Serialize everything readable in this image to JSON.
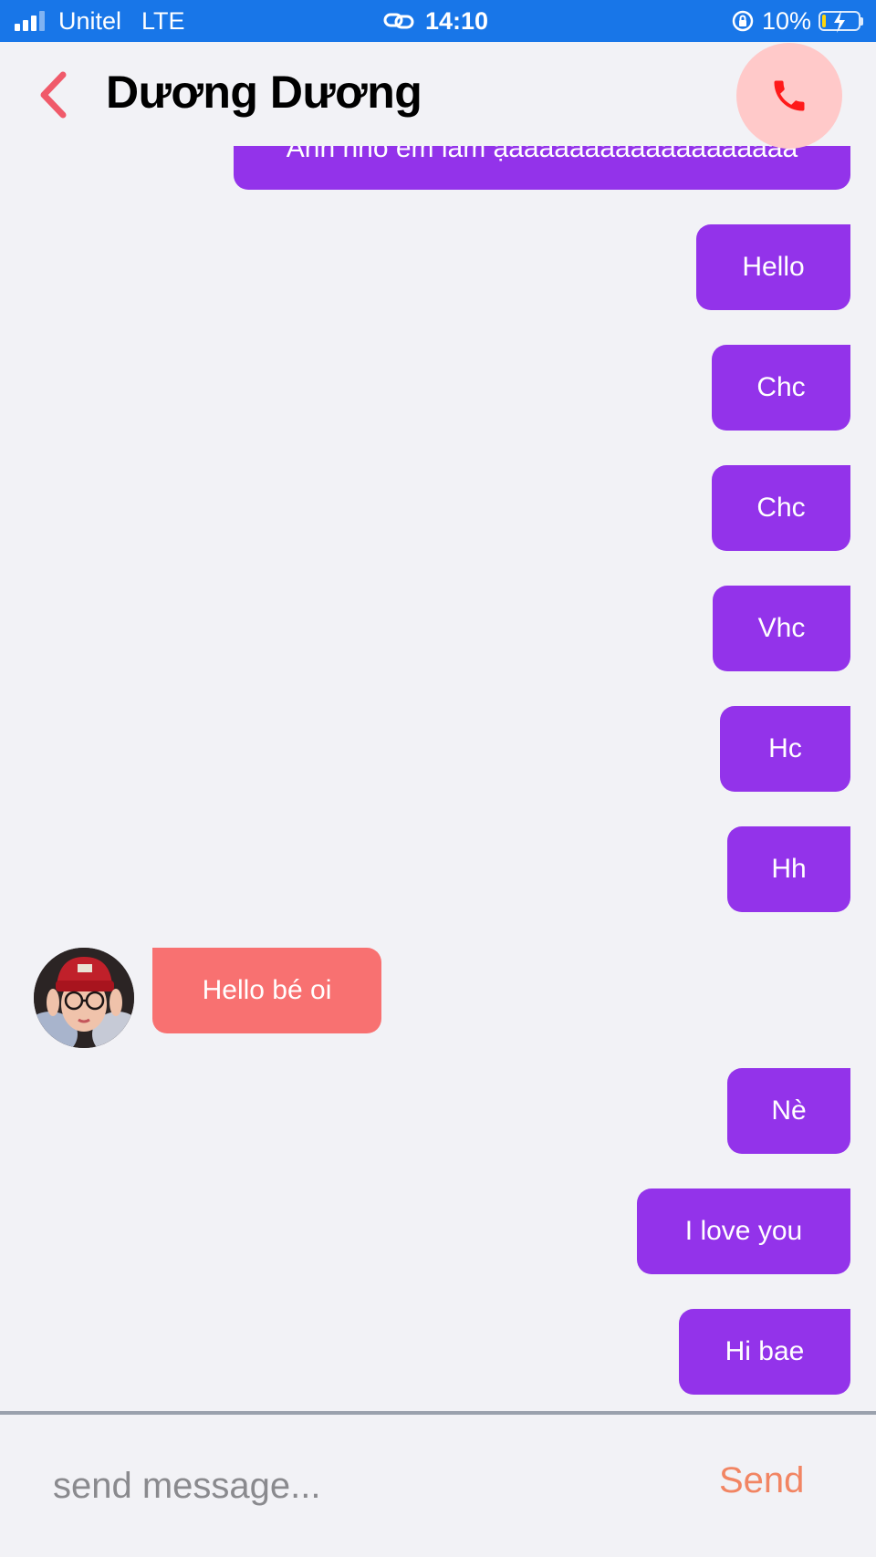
{
  "status_bar": {
    "carrier": "Unitel",
    "network": "LTE",
    "time": "14:10",
    "battery_percent": "10%",
    "battery_level": 0.1,
    "signal_bars_on": 3,
    "signal_bars_total": 4,
    "icons": [
      "signal-icon",
      "link-icon",
      "orientation-lock-icon",
      "battery-charging-icon"
    ],
    "colors": {
      "background": "#1876e8",
      "battery_fill": "#ffd60a"
    }
  },
  "header": {
    "title": "Dương Dương",
    "back_icon": "chevron-left-icon",
    "call_icon": "phone-icon",
    "colors": {
      "back": "#f05a6a",
      "call_icon": "#ff1a1a",
      "call_bg": "#ffc9c9"
    }
  },
  "messages": [
    {
      "direction": "outgoing",
      "text": "Anh nho em lam ạaaaaaaaaaaaaaaaaaaa"
    },
    {
      "direction": "outgoing",
      "text": "Hello"
    },
    {
      "direction": "outgoing",
      "text": "Chc"
    },
    {
      "direction": "outgoing",
      "text": "Chc"
    },
    {
      "direction": "outgoing",
      "text": "Vhc"
    },
    {
      "direction": "outgoing",
      "text": "Hc"
    },
    {
      "direction": "outgoing",
      "text": "Hh"
    },
    {
      "direction": "incoming",
      "text": "Hello bé oi"
    },
    {
      "direction": "outgoing",
      "text": "Nè"
    },
    {
      "direction": "outgoing",
      "text": "I love you"
    },
    {
      "direction": "outgoing",
      "text": "Hi bae"
    }
  ],
  "colors": {
    "outgoing_bubble": "#9333ea",
    "incoming_bubble": "#f87171",
    "background": "#f2f2f6"
  },
  "input": {
    "placeholder": "send message...",
    "value": "",
    "send_label": "Send",
    "send_color": "#f28563"
  }
}
